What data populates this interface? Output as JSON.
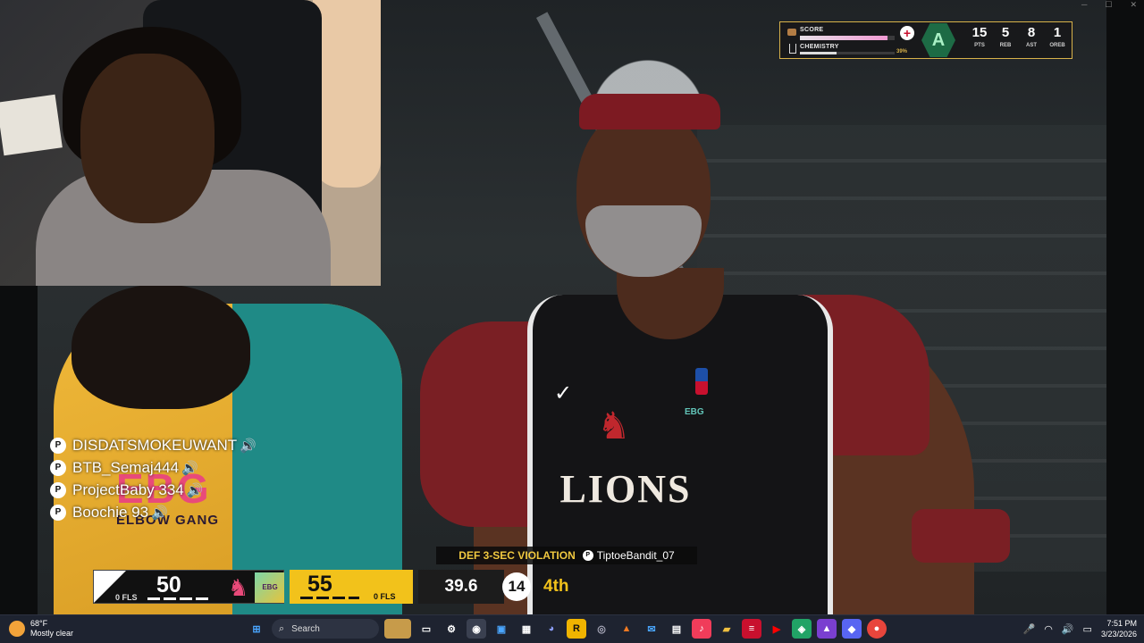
{
  "window": {
    "controls": [
      "─",
      "☐",
      "✕"
    ]
  },
  "hud": {
    "score_label": "SCORE",
    "chemistry_label": "CHEMISTRY",
    "chemistry_pct": "39%",
    "chemistry_fill": 0.39,
    "score_fill": 0.92,
    "grade": "A",
    "stats": [
      {
        "value": "15",
        "label": "PTS"
      },
      {
        "value": "5",
        "label": "REB"
      },
      {
        "value": "8",
        "label": "AST"
      },
      {
        "value": "1",
        "label": "OREB"
      }
    ]
  },
  "party": [
    {
      "name": "DISDATSMOKEUWANT"
    },
    {
      "name": "BTB_Semaj444"
    },
    {
      "name": "ProjectBaby 334"
    },
    {
      "name": "Boochie 93"
    }
  ],
  "jerseys": {
    "home_text": "LIONS",
    "away_text": "EBG",
    "away_sub": "ELBOW GANG"
  },
  "violation": {
    "type": "DEF 3-SEC VIOLATION",
    "player": "TiptoeBandit_07"
  },
  "scoreboard": {
    "home_score": "50",
    "home_fouls": "0 FLS",
    "away_score": "55",
    "away_fouls": "0 FLS",
    "game_clock": "39.6",
    "shot_clock": "14",
    "quarter": "4th",
    "away_color": "#f2c21b"
  },
  "taskbar": {
    "weather_temp": "68°F",
    "weather_desc": "Mostly clear",
    "search_placeholder": "Search",
    "time": "7:51 PM",
    "date": "3/23/2026"
  }
}
